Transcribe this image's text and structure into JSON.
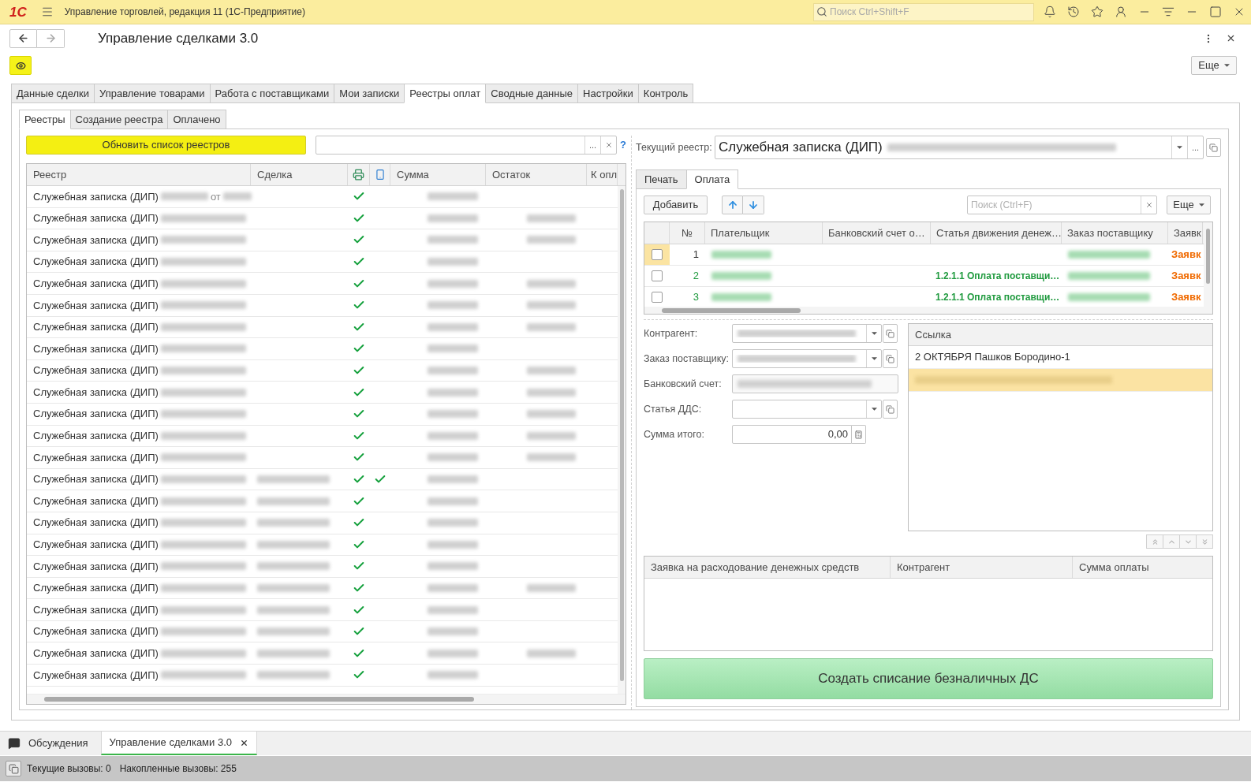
{
  "app_bar": {
    "logo": "1С",
    "title": "Управление торговлей, редакция 11 (1С-Предприятие)",
    "search_placeholder": "Поиск Ctrl+Shift+F"
  },
  "form": {
    "title": "Управление сделками 3.0",
    "more_button": "Еще"
  },
  "tabs": [
    {
      "label": "Данные сделки",
      "selected": false
    },
    {
      "label": "Управление товарами",
      "selected": false
    },
    {
      "label": "Работа с поставщиками",
      "selected": false
    },
    {
      "label": "Мои записки",
      "selected": false
    },
    {
      "label": "Реестры оплат",
      "selected": true
    },
    {
      "label": "Сводные данные",
      "selected": false
    },
    {
      "label": "Настройки",
      "selected": false
    },
    {
      "label": "Контроль",
      "selected": false
    }
  ],
  "subtabs": [
    {
      "label": "Реестры",
      "selected": true
    },
    {
      "label": "Создание реестра",
      "selected": false
    },
    {
      "label": "Оплачено",
      "selected": false
    }
  ],
  "registers": {
    "refresh_button": "Обновить список реестров",
    "choose_button": "...",
    "help": "?",
    "columns": [
      {
        "kind": "text",
        "label": "Реестр"
      },
      {
        "kind": "text",
        "label": "Сделка"
      },
      {
        "kind": "printer"
      },
      {
        "kind": "phone"
      },
      {
        "kind": "text",
        "label": "Сумма"
      },
      {
        "kind": "text",
        "label": "Остаток"
      },
      {
        "kind": "text",
        "label": "К опл"
      }
    ],
    "rows": [
      {
        "title": "Служебная записка (ДИП)",
        "fragment": "от",
        "deal_redacted": false,
        "column_3_checked": true,
        "column_4_checked": false,
        "remainder_redacted": false
      },
      {
        "title": "Служебная записка (ДИП)",
        "deal_redacted": false,
        "column_3_checked": true,
        "column_4_checked": false,
        "remainder_redacted": true
      },
      {
        "title": "Служебная записка (ДИП)",
        "deal_redacted": false,
        "column_3_checked": true,
        "column_4_checked": false,
        "remainder_redacted": true
      },
      {
        "title": "Служебная записка (ДИП)",
        "deal_redacted": false,
        "column_3_checked": true,
        "column_4_checked": false,
        "remainder_redacted": false
      },
      {
        "title": "Служебная записка (ДИП)",
        "deal_redacted": false,
        "column_3_checked": true,
        "column_4_checked": false,
        "remainder_redacted": true
      },
      {
        "title": "Служебная записка (ДИП)",
        "deal_redacted": false,
        "column_3_checked": true,
        "column_4_checked": false,
        "remainder_redacted": true
      },
      {
        "title": "Служебная записка (ДИП)",
        "deal_redacted": false,
        "column_3_checked": true,
        "column_4_checked": false,
        "remainder_redacted": true
      },
      {
        "title": "Служебная записка (ДИП)",
        "deal_redacted": false,
        "column_3_checked": true,
        "column_4_checked": false,
        "remainder_redacted": false
      },
      {
        "title": "Служебная записка (ДИП)",
        "deal_redacted": false,
        "column_3_checked": true,
        "column_4_checked": false,
        "remainder_redacted": true
      },
      {
        "title": "Служебная записка (ДИП)",
        "deal_redacted": false,
        "column_3_checked": true,
        "column_4_checked": false,
        "remainder_redacted": true
      },
      {
        "title": "Служебная записка (ДИП)",
        "deal_redacted": false,
        "column_3_checked": true,
        "column_4_checked": false,
        "remainder_redacted": true
      },
      {
        "title": "Служебная записка (ДИП)",
        "deal_redacted": false,
        "column_3_checked": true,
        "column_4_checked": false,
        "remainder_redacted": true
      },
      {
        "title": "Служебная записка (ДИП)",
        "deal_redacted": false,
        "column_3_checked": true,
        "column_4_checked": false,
        "remainder_redacted": true
      },
      {
        "title": "Служебная записка (ДИП)",
        "deal_redacted": true,
        "column_3_checked": true,
        "column_4_checked": true,
        "remainder_redacted": false
      },
      {
        "title": "Служебная записка (ДИП)",
        "deal_redacted": true,
        "column_3_checked": true,
        "column_4_checked": false,
        "remainder_redacted": false
      },
      {
        "title": "Служебная записка (ДИП)",
        "deal_redacted": true,
        "column_3_checked": true,
        "column_4_checked": false,
        "remainder_redacted": false
      },
      {
        "title": "Служебная записка (ДИП)",
        "deal_redacted": true,
        "column_3_checked": true,
        "column_4_checked": false,
        "remainder_redacted": false
      },
      {
        "title": "Служебная записка (ДИП)",
        "deal_redacted": true,
        "column_3_checked": true,
        "column_4_checked": false,
        "remainder_redacted": false
      },
      {
        "title": "Служебная записка (ДИП)",
        "deal_redacted": true,
        "column_3_checked": true,
        "column_4_checked": false,
        "remainder_redacted": true
      },
      {
        "title": "Служебная записка (ДИП)",
        "deal_redacted": true,
        "column_3_checked": true,
        "column_4_checked": false,
        "remainder_redacted": false
      },
      {
        "title": "Служебная записка (ДИП)",
        "deal_redacted": true,
        "column_3_checked": true,
        "column_4_checked": false,
        "remainder_redacted": false
      },
      {
        "title": "Служебная записка (ДИП)",
        "deal_redacted": true,
        "column_3_checked": true,
        "column_4_checked": false,
        "remainder_redacted": true
      },
      {
        "title": "Служебная записка (ДИП)",
        "deal_redacted": true,
        "column_3_checked": true,
        "column_4_checked": false,
        "remainder_redacted": false
      }
    ]
  },
  "current_register": {
    "label": "Текущий реестр:",
    "value": "Служебная записка (ДИП)",
    "choose_button": "..."
  },
  "payment_tabs": [
    {
      "label": "Печать",
      "selected": false
    },
    {
      "label": "Оплата",
      "selected": true
    }
  ],
  "payments": {
    "add_button": "Добавить",
    "search_placeholder": "Поиск (Ctrl+F)",
    "more_button": "Еще",
    "columns": [
      "№",
      "Плательщик",
      "Банковский счет о…",
      "Статья движения денеж…",
      "Заказ поставщику",
      "Заявк"
    ],
    "rows": [
      {
        "number": "1",
        "checked": false,
        "selected": true,
        "color": "#333333",
        "status": "Заявк"
      },
      {
        "number": "2",
        "checked": false,
        "selected": false,
        "color": "#1f9a3e",
        "article": "1.2.1.1 Оплата поставщи…",
        "status": "Заявк"
      },
      {
        "number": "3",
        "checked": false,
        "selected": false,
        "color": "#1f9a3e",
        "article": "1.2.1.1 Оплата поставщи…",
        "status": "Заявк"
      }
    ]
  },
  "details": {
    "fields": [
      {
        "label": "Контрагент:",
        "kind": "select",
        "redacted": true
      },
      {
        "label": "Заказ поставщику:",
        "kind": "select",
        "redacted": true
      },
      {
        "label": "Банковский счет:",
        "kind": "text",
        "redacted": true
      },
      {
        "label": "Статья ДДС:",
        "kind": "select",
        "redacted": false
      },
      {
        "label": "Сумма итого:",
        "kind": "number",
        "value": "0,00"
      }
    ]
  },
  "links": {
    "header": "Ссылка",
    "items": [
      {
        "text": "2 ОКТЯБРЯ Пашков Бородино-1",
        "selected": false
      },
      {
        "selected": true
      }
    ]
  },
  "requests": {
    "columns": [
      "Заявка на расходование денежных средств",
      "Контрагент",
      "Сумма оплаты"
    ]
  },
  "create_button": "Создать списание безналичных ДС",
  "taskbar": [
    {
      "kind": "panel",
      "label": "Обсуждения",
      "selected": false
    },
    {
      "kind": "window",
      "label": "Управление сделками 3.0",
      "selected": true
    }
  ],
  "status_bar": [
    "Текущие вызовы: 0",
    "Накопленные вызовы: 255"
  ]
}
